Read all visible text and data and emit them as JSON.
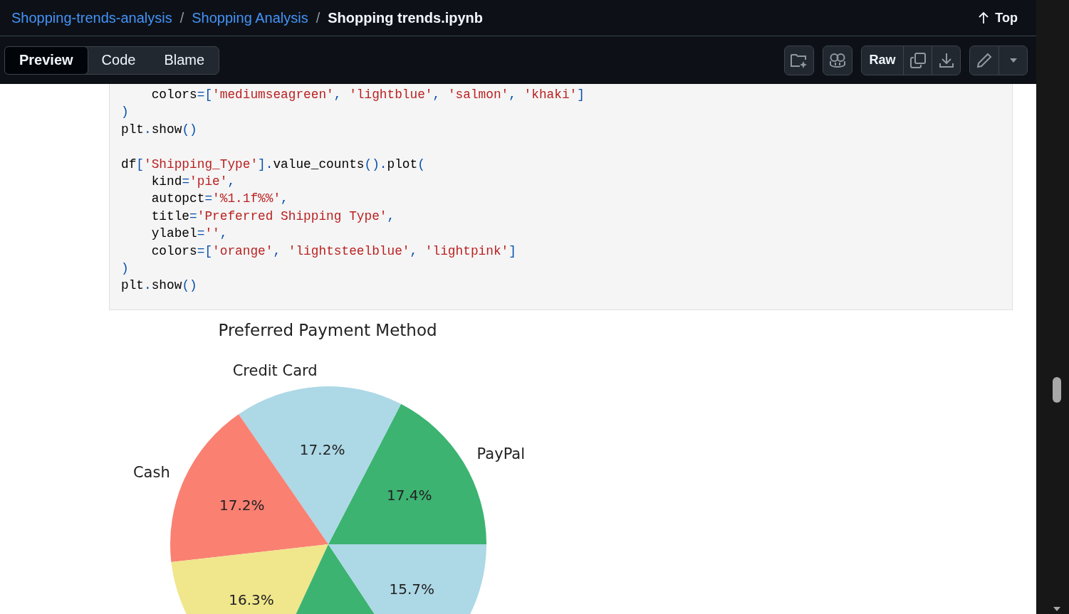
{
  "breadcrumb": {
    "links": [
      "Shopping-trends-analysis",
      "Shopping Analysis"
    ],
    "separators": [
      "/",
      "/"
    ],
    "current": "Shopping trends.ipynb"
  },
  "top_link": "Top",
  "tabs": [
    {
      "label": "Preview",
      "selected": true
    },
    {
      "label": "Code",
      "selected": false
    },
    {
      "label": "Blame",
      "selected": false
    }
  ],
  "raw_button": "Raw",
  "code_blocks": [
    [
      [
        {
          "text": "    colors",
          "kind": "name"
        },
        {
          "text": "=[",
          "kind": "punct"
        },
        {
          "text": "'mediumseagreen'",
          "kind": "string"
        },
        {
          "text": ", ",
          "kind": "punct"
        },
        {
          "text": "'lightblue'",
          "kind": "string"
        },
        {
          "text": ", ",
          "kind": "punct"
        },
        {
          "text": "'salmon'",
          "kind": "string"
        },
        {
          "text": ", ",
          "kind": "punct"
        },
        {
          "text": "'khaki'",
          "kind": "string"
        },
        {
          "text": "]",
          "kind": "punct"
        }
      ],
      [
        {
          "text": ")",
          "kind": "punct"
        }
      ],
      [
        {
          "text": "plt",
          "kind": "name"
        },
        {
          "text": ".",
          "kind": "punct"
        },
        {
          "text": "show",
          "kind": "name"
        },
        {
          "text": "()",
          "kind": "punct"
        }
      ]
    ],
    [
      [
        {
          "text": "df",
          "kind": "name"
        },
        {
          "text": "[",
          "kind": "punct"
        },
        {
          "text": "'Shipping_Type'",
          "kind": "string"
        },
        {
          "text": "]",
          "kind": "punct"
        },
        {
          "text": ".",
          "kind": "punct"
        },
        {
          "text": "value_counts",
          "kind": "name"
        },
        {
          "text": "().",
          "kind": "punct"
        },
        {
          "text": "plot",
          "kind": "name"
        },
        {
          "text": "(",
          "kind": "punct"
        }
      ],
      [
        {
          "text": "    kind",
          "kind": "name"
        },
        {
          "text": "=",
          "kind": "punct"
        },
        {
          "text": "'pie'",
          "kind": "string"
        },
        {
          "text": ",",
          "kind": "punct"
        }
      ],
      [
        {
          "text": "    autopct",
          "kind": "name"
        },
        {
          "text": "=",
          "kind": "punct"
        },
        {
          "text": "'%1.1f%%'",
          "kind": "string"
        },
        {
          "text": ",",
          "kind": "punct"
        }
      ],
      [
        {
          "text": "    title",
          "kind": "name"
        },
        {
          "text": "=",
          "kind": "punct"
        },
        {
          "text": "'Preferred Shipping Type'",
          "kind": "string"
        },
        {
          "text": ",",
          "kind": "punct"
        }
      ],
      [
        {
          "text": "    ylabel",
          "kind": "name"
        },
        {
          "text": "=",
          "kind": "punct"
        },
        {
          "text": "''",
          "kind": "string"
        },
        {
          "text": ",",
          "kind": "punct"
        }
      ],
      [
        {
          "text": "    colors",
          "kind": "name"
        },
        {
          "text": "=[",
          "kind": "punct"
        },
        {
          "text": "'orange'",
          "kind": "string"
        },
        {
          "text": ", ",
          "kind": "punct"
        },
        {
          "text": "'lightsteelblue'",
          "kind": "string"
        },
        {
          "text": ", ",
          "kind": "punct"
        },
        {
          "text": "'lightpink'",
          "kind": "string"
        },
        {
          "text": "]",
          "kind": "punct"
        }
      ],
      [
        {
          "text": ")",
          "kind": "punct"
        }
      ],
      [
        {
          "text": "plt",
          "kind": "name"
        },
        {
          "text": ".",
          "kind": "punct"
        },
        {
          "text": "show",
          "kind": "name"
        },
        {
          "text": "()",
          "kind": "punct"
        }
      ]
    ]
  ],
  "chart_data": {
    "type": "pie",
    "title": "Preferred Payment Method",
    "categories": [
      "PayPal",
      "Credit Card",
      "Cash",
      null,
      null,
      null
    ],
    "values": [
      17.4,
      17.2,
      17.2,
      16.3,
      16.2,
      15.7
    ],
    "colors": [
      "#3cb371",
      "#add8e6",
      "#fa8072",
      "#f0e68c",
      "#3cb371",
      "#add8e6"
    ],
    "value_labels": [
      "17.4%",
      "17.2%",
      "17.2%",
      "16.3%",
      null,
      "15.7%"
    ]
  }
}
